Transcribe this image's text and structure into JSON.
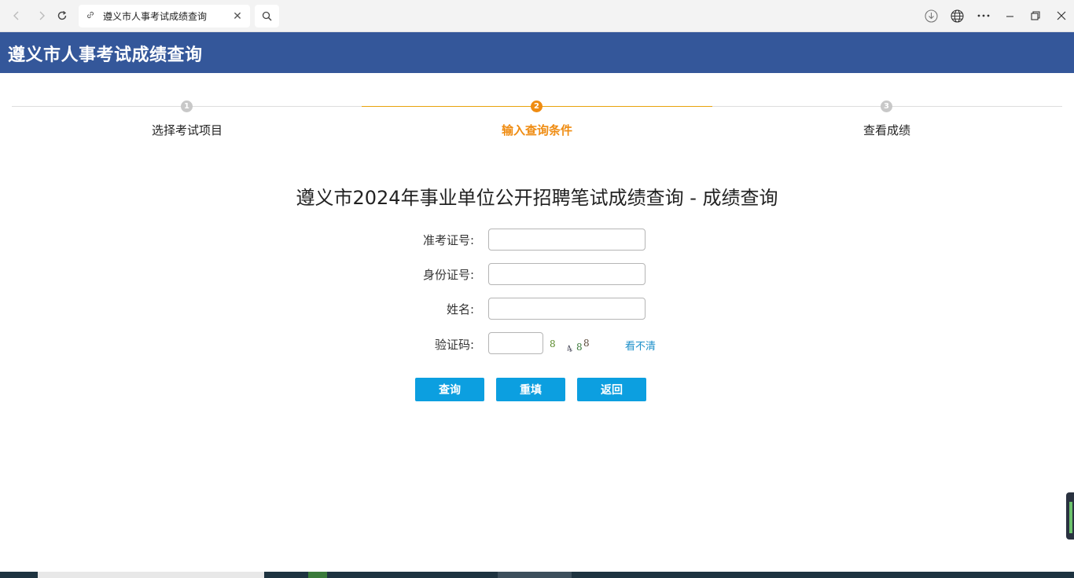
{
  "browser": {
    "tab_title": "遵义市人事考试成绩查询",
    "icons": {
      "back": "back-arrow-icon",
      "forward": "forward-arrow-icon",
      "reload": "reload-icon",
      "link": "link-icon",
      "close_tab": "close-icon",
      "search": "search-icon",
      "download": "download-icon",
      "globe": "globe-icon",
      "more": "more-icon",
      "minimize": "minimize-icon",
      "restore": "restore-icon",
      "close_window": "close-window-icon"
    }
  },
  "site": {
    "title": "遵义市人事考试成绩查询"
  },
  "steps": [
    {
      "number": "1",
      "label": "选择考试项目",
      "active": false
    },
    {
      "number": "2",
      "label": "输入查询条件",
      "active": true
    },
    {
      "number": "3",
      "label": "查看成绩",
      "active": false
    }
  ],
  "form": {
    "title": "遵义市2024年事业单位公开招聘笔试成绩查询 - 成绩查询",
    "fields": {
      "ticket_label": "准考证号:",
      "ticket_value": "",
      "id_label": "身份证号:",
      "id_value": "",
      "name_label": "姓名:",
      "name_value": "",
      "captcha_label": "验证码:",
      "captcha_value": ""
    },
    "captcha_refresh": "看不清",
    "buttons": {
      "query": "查询",
      "reset": "重填",
      "back": "返回"
    }
  },
  "colors": {
    "header_bg": "#34579a",
    "step_active": "#ef8c12",
    "button_bg": "#0c9fe0",
    "link": "#1c8fc9"
  }
}
